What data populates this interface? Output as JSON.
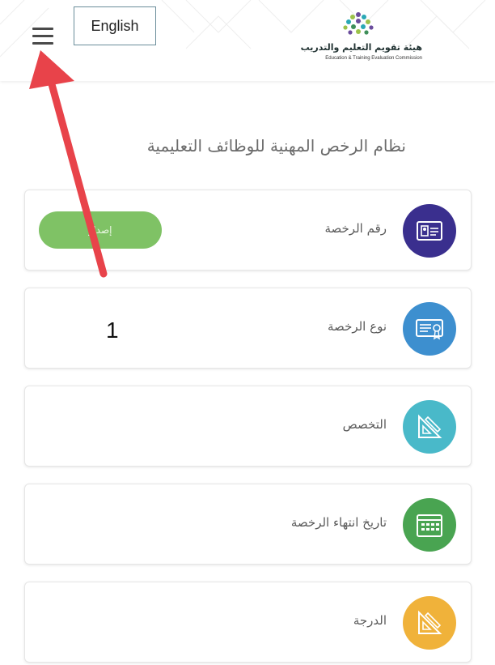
{
  "header": {
    "language_button": "English",
    "logo": {
      "arabic": "هيئة تقويم التعليم والتدريب",
      "english": "Education & Training Evaluation Commission"
    }
  },
  "page_title": "نظام الرخص المهنية للوظائف التعليمية",
  "fields": [
    {
      "label": "رقم الرخصة",
      "icon": "id-card-icon",
      "color": "#3a2f8e",
      "button": "إصدار"
    },
    {
      "label": "نوع الرخصة",
      "icon": "certificate-icon",
      "color": "#3d8fcf",
      "value": "1"
    },
    {
      "label": "التخصص",
      "icon": "set-square-ruler-icon",
      "color": "#49b9c9"
    },
    {
      "label": "تاريخ انتهاء الرخصة",
      "icon": "calendar-icon",
      "color": "#49a451"
    },
    {
      "label": "الدرجة",
      "icon": "set-square-ruler-icon",
      "color": "#f0b23a"
    }
  ],
  "annotation": {
    "arrow_color": "#e8434a"
  }
}
